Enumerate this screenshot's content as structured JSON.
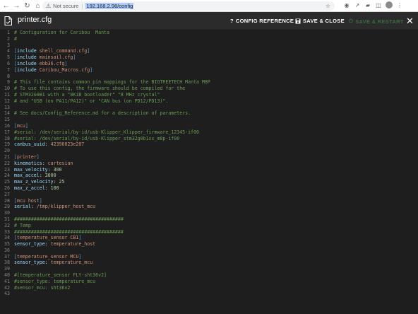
{
  "browser": {
    "security_label": "Not secure",
    "url": "192.168.2.98/config"
  },
  "header": {
    "title": "printer.cfg",
    "config_reference_label": "CONFIG REFERENCE",
    "save_close_label": "SAVE & CLOSE",
    "save_restart_label": "SAVE & RESTART",
    "icons": {
      "file": "file-icon",
      "help": "question-icon",
      "save": "floppy-icon",
      "restart": "power-icon",
      "close": "close-icon"
    },
    "colors": {
      "header_bg": "#2b2b2b",
      "editor_bg": "#1e1e1e",
      "restart_disabled": "#3a6b3e"
    }
  },
  "editor": {
    "lines": [
      {
        "n": "1",
        "parts": [
          {
            "t": "# Configuration for Caribou  Manta",
            "c": "comment"
          }
        ]
      },
      {
        "n": "2",
        "parts": [
          {
            "t": "#",
            "c": "comment"
          }
        ]
      },
      {
        "n": "3",
        "parts": []
      },
      {
        "n": "4",
        "parts": [
          {
            "t": "[",
            "c": "bracket"
          },
          {
            "t": "include",
            "c": "key"
          },
          {
            "t": " shell_command.cfg",
            "c": "val"
          },
          {
            "t": "]",
            "c": "bracket"
          }
        ]
      },
      {
        "n": "5",
        "parts": [
          {
            "t": "[",
            "c": "bracket"
          },
          {
            "t": "include",
            "c": "key"
          },
          {
            "t": " mainsail.cfg",
            "c": "val"
          },
          {
            "t": "]",
            "c": "bracket"
          }
        ]
      },
      {
        "n": "6",
        "parts": [
          {
            "t": "[",
            "c": "bracket"
          },
          {
            "t": "include",
            "c": "key"
          },
          {
            "t": " ebb36.cfg",
            "c": "val"
          },
          {
            "t": "]",
            "c": "bracket"
          }
        ]
      },
      {
        "n": "7",
        "parts": [
          {
            "t": "[",
            "c": "bracket"
          },
          {
            "t": "include",
            "c": "key"
          },
          {
            "t": " Caribou_Macros.cfg",
            "c": "val"
          },
          {
            "t": "]",
            "c": "bracket"
          }
        ]
      },
      {
        "n": "8",
        "parts": []
      },
      {
        "n": "9",
        "parts": [
          {
            "t": "# This file contains common pin mappings for the BIGTREETECH Manta M8P",
            "c": "comment"
          }
        ]
      },
      {
        "n": "10",
        "parts": [
          {
            "t": "# To use this config, the firmware should be compiled for the",
            "c": "comment"
          }
        ]
      },
      {
        "n": "11",
        "parts": [
          {
            "t": "# STM32G0B1 with a \"8KiB bootloader\" \"8 MHz crystal\"",
            "c": "comment"
          }
        ]
      },
      {
        "n": "12",
        "parts": [
          {
            "t": "# and \"USB (on PA11/PA12)\" or \"CAN bus (on PD12/PD13)\".",
            "c": "comment"
          }
        ]
      },
      {
        "n": "13",
        "parts": []
      },
      {
        "n": "14",
        "parts": [
          {
            "t": "# See docs/Config_Reference.md for a description of parameters.",
            "c": "comment"
          }
        ]
      },
      {
        "n": "15",
        "parts": []
      },
      {
        "n": "16",
        "parts": [
          {
            "t": "[",
            "c": "bracket"
          },
          {
            "t": "mcu",
            "c": "section"
          },
          {
            "t": "]",
            "c": "bracket"
          }
        ]
      },
      {
        "n": "17",
        "parts": [
          {
            "t": "#serial: /dev/serial/by-id/usb-Klipper_Klipper_firmware_12345-if00",
            "c": "comment"
          }
        ]
      },
      {
        "n": "18",
        "parts": [
          {
            "t": "#serial: /dev/serial/by-id/usb-Klipper_stm32g0b1xx_m8p-if00",
            "c": "comment"
          }
        ]
      },
      {
        "n": "19",
        "parts": [
          {
            "t": "canbus_uuid",
            "c": "key"
          },
          {
            "t": ": ",
            "c": "plain"
          },
          {
            "t": "42396023e207",
            "c": "val"
          }
        ]
      },
      {
        "n": "20",
        "parts": []
      },
      {
        "n": "21",
        "parts": [
          {
            "t": "[",
            "c": "bracket"
          },
          {
            "t": "printer",
            "c": "section"
          },
          {
            "t": "]",
            "c": "bracket"
          }
        ]
      },
      {
        "n": "22",
        "parts": [
          {
            "t": "kinematics",
            "c": "key"
          },
          {
            "t": ": ",
            "c": "plain"
          },
          {
            "t": "cartesian",
            "c": "val"
          }
        ]
      },
      {
        "n": "23",
        "parts": [
          {
            "t": "max_velocity",
            "c": "key"
          },
          {
            "t": ": ",
            "c": "plain"
          },
          {
            "t": "300",
            "c": "num"
          }
        ]
      },
      {
        "n": "24",
        "parts": [
          {
            "t": "max_accel",
            "c": "key"
          },
          {
            "t": ": ",
            "c": "plain"
          },
          {
            "t": "3000",
            "c": "num"
          }
        ]
      },
      {
        "n": "25",
        "parts": [
          {
            "t": "max_z_velocity",
            "c": "key"
          },
          {
            "t": ": ",
            "c": "plain"
          },
          {
            "t": "25",
            "c": "num"
          }
        ]
      },
      {
        "n": "26",
        "parts": [
          {
            "t": "max_z_accel",
            "c": "key"
          },
          {
            "t": ": ",
            "c": "plain"
          },
          {
            "t": "100",
            "c": "num"
          }
        ]
      },
      {
        "n": "27",
        "parts": []
      },
      {
        "n": "28",
        "parts": [
          {
            "t": "[",
            "c": "bracket"
          },
          {
            "t": "mcu host",
            "c": "section"
          },
          {
            "t": "]",
            "c": "bracket"
          }
        ]
      },
      {
        "n": "29",
        "parts": [
          {
            "t": "serial",
            "c": "key"
          },
          {
            "t": ": ",
            "c": "plain"
          },
          {
            "t": "/tmp/klipper_host_mcu",
            "c": "val"
          }
        ]
      },
      {
        "n": "30",
        "parts": []
      },
      {
        "n": "31",
        "parts": [
          {
            "t": "#######################################",
            "c": "comment"
          }
        ]
      },
      {
        "n": "32",
        "parts": [
          {
            "t": "# Temp",
            "c": "comment"
          }
        ]
      },
      {
        "n": "33",
        "parts": [
          {
            "t": "#######################################",
            "c": "comment"
          }
        ]
      },
      {
        "n": "34",
        "parts": [
          {
            "t": "[",
            "c": "bracket"
          },
          {
            "t": "temperature_sensor CB1",
            "c": "section"
          },
          {
            "t": "]",
            "c": "bracket"
          }
        ]
      },
      {
        "n": "35",
        "parts": [
          {
            "t": "sensor_type",
            "c": "key"
          },
          {
            "t": ": ",
            "c": "plain"
          },
          {
            "t": "temperature_host",
            "c": "val"
          }
        ]
      },
      {
        "n": "36",
        "parts": []
      },
      {
        "n": "37",
        "parts": [
          {
            "t": "[",
            "c": "bracket"
          },
          {
            "t": "temperature_sensor MCU",
            "c": "section"
          },
          {
            "t": "]",
            "c": "bracket"
          }
        ]
      },
      {
        "n": "38",
        "parts": [
          {
            "t": "sensor_type",
            "c": "key"
          },
          {
            "t": ": ",
            "c": "plain"
          },
          {
            "t": "temperature_mcu",
            "c": "val"
          }
        ]
      },
      {
        "n": "39",
        "parts": []
      },
      {
        "n": "40",
        "parts": [
          {
            "t": "#[temperature_sensor FLY-sht36v2]",
            "c": "comment"
          }
        ]
      },
      {
        "n": "41",
        "parts": [
          {
            "t": "#sensor_type: temperature_mcu",
            "c": "comment"
          }
        ]
      },
      {
        "n": "42",
        "parts": [
          {
            "t": "#sensor_mcu: sht36v2",
            "c": "comment"
          }
        ]
      },
      {
        "n": "43",
        "parts": []
      }
    ]
  }
}
